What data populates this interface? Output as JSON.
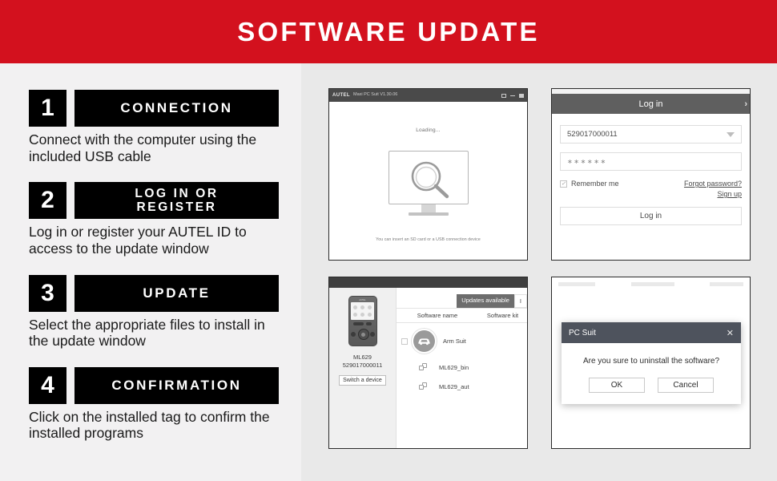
{
  "banner": {
    "title": "SOFTWARE UPDATE",
    "bg_color": "#d3111e",
    "text_color": "#ffffff"
  },
  "steps": [
    {
      "number": "1",
      "label": "CONNECTION",
      "description": "Connect with the computer using the included USB cable"
    },
    {
      "number": "2",
      "label": "LOG IN OR REGISTER",
      "label_line1": "LOG IN OR",
      "label_line2": "REGISTER",
      "description": "Log in or register your AUTEL ID to access to the update window"
    },
    {
      "number": "3",
      "label": "UPDATE",
      "description": "Select the appropriate files to install in the update window"
    },
    {
      "number": "4",
      "label": "CONFIRMATION",
      "description": "Click on the installed tag to confirm the installed programs"
    }
  ],
  "screens": {
    "connection": {
      "window_logo": "AUTEL",
      "window_title": "Maxi PC Suit V1.30.06",
      "controls": [
        "restore-icon",
        "minimize-icon",
        "close-icon"
      ],
      "loading_text": "Loading...",
      "hint_text": "You can insert an SD card or a USB connection device"
    },
    "login": {
      "title": "Log in",
      "chevron": "›",
      "username_value": "529017000011",
      "password_value": "∗∗∗∗∗∗",
      "remember_label": "Remember me",
      "remember_checked": true,
      "forgot_link": "Forgot password?",
      "signup_link": "Sign up",
      "login_button": "Log in"
    },
    "update": {
      "device_name": "ML629",
      "device_serial": "529017000011",
      "switch_button": "Switch a device",
      "tab_active": "Updates available",
      "tab_inactive": "I",
      "col_software_name": "Software name",
      "col_software_kit": "Software kit",
      "rows": [
        {
          "name": "Arm Suit",
          "icon": "car-icon",
          "checked": false
        },
        {
          "name": "ML629_bin",
          "icon": "file-copy-icon"
        },
        {
          "name": "ML629_aut",
          "icon": "file-copy-icon"
        }
      ]
    },
    "confirm": {
      "dialog_title": "PC Suit",
      "close_icon": "✕",
      "message": "Are you sure to uninstall the software?",
      "ok_button": "OK",
      "cancel_button": "Cancel"
    }
  }
}
